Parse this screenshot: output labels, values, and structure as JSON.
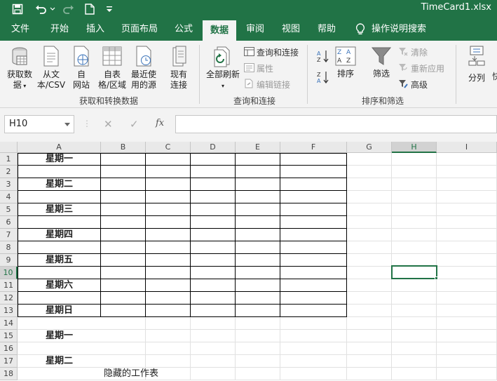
{
  "window": {
    "title": "TimeCard1.xlsx",
    "accent": "#217346"
  },
  "quick_access": [
    "save-icon",
    "undo-icon",
    "redo-icon",
    "new-icon",
    "customize-icon"
  ],
  "tabs": [
    {
      "label": "文件"
    },
    {
      "label": "开始"
    },
    {
      "label": "插入"
    },
    {
      "label": "页面布局"
    },
    {
      "label": "公式"
    },
    {
      "label": "数据",
      "active": true
    },
    {
      "label": "审阅"
    },
    {
      "label": "视图"
    },
    {
      "label": "帮助"
    },
    {
      "label": "操作说明搜索"
    }
  ],
  "ribbon": {
    "get_transform": {
      "label": "获取和转换数据",
      "buttons": [
        {
          "line1": "获取数",
          "line2": "据"
        },
        {
          "line1": "从文",
          "line2": "本/CSV"
        },
        {
          "line1": "自",
          "line2": "网站"
        },
        {
          "line1": "自表",
          "line2": "格/区域"
        },
        {
          "line1": "最近使",
          "line2": "用的源"
        },
        {
          "line1": "现有",
          "line2": "连接"
        }
      ]
    },
    "queries": {
      "label": "查询和连接",
      "refresh_all": "全部刷新",
      "items": [
        "查询和连接",
        "属性",
        "编辑链接"
      ]
    },
    "sort_filter": {
      "label": "排序和筛选",
      "sort": "排序",
      "filter": "筛选",
      "items": [
        "清除",
        "重新应用",
        "高级"
      ]
    },
    "data_tools": {
      "split": "分列",
      "cut": "快"
    }
  },
  "formula_bar": {
    "name_box": "H10",
    "cancel": "✕",
    "enter": "✓",
    "fx": "fx",
    "value": ""
  },
  "columns": [
    "A",
    "B",
    "C",
    "D",
    "E",
    "F",
    "G",
    "H",
    "I"
  ],
  "rows": [
    "1",
    "2",
    "3",
    "4",
    "5",
    "6",
    "7",
    "8",
    "9",
    "10",
    "11",
    "12",
    "13",
    "14",
    "15",
    "16",
    "17",
    "18"
  ],
  "cells": {
    "A1": "星期一",
    "A3": "星期二",
    "A5": "星期三",
    "A7": "星期四",
    "A9": "星期五",
    "A11": "星期六",
    "A13": "星期日",
    "A15": "星期一",
    "A17": "星期二",
    "B18": "隐藏的工作表"
  },
  "selected_cell": "H10"
}
